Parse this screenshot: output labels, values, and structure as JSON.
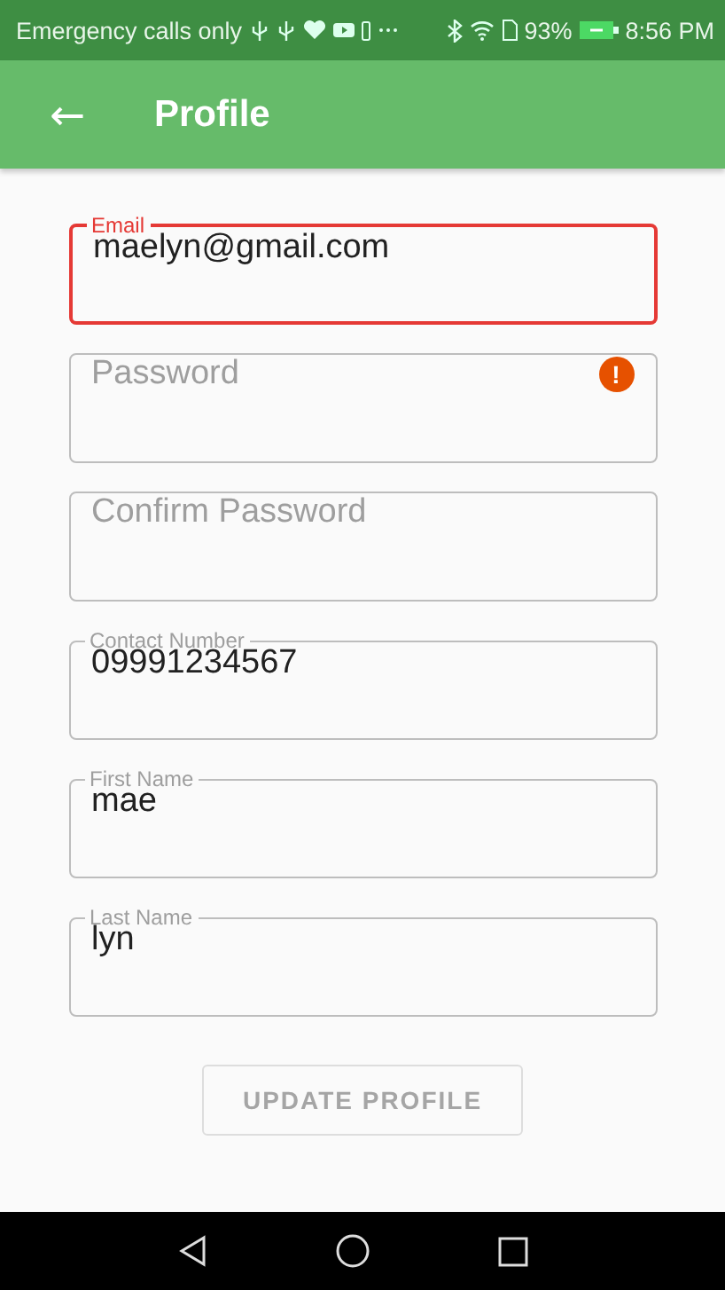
{
  "status_bar": {
    "carrier": "Emergency calls only",
    "battery": "93%",
    "time": "8:56 PM"
  },
  "app_bar": {
    "back": "←",
    "title": "Profile"
  },
  "fields": [
    {
      "label": "Email",
      "value": "maelyn@gmail.com",
      "error": true,
      "alert": false
    },
    {
      "placeholder": "Password",
      "error": false,
      "alert": true
    },
    {
      "placeholder": "Confirm Password",
      "error": false,
      "alert": false
    },
    {
      "label": "Contact Number",
      "value": "09991234567",
      "error": false,
      "alert": false
    },
    {
      "label": "First Name",
      "value": "mae",
      "error": false,
      "alert": false
    },
    {
      "label": "Last Name",
      "value": "lyn",
      "error": false,
      "alert": false
    }
  ],
  "button": {
    "label": "UPDATE PROFILE",
    "disabled": true
  },
  "alert_mark": "!"
}
